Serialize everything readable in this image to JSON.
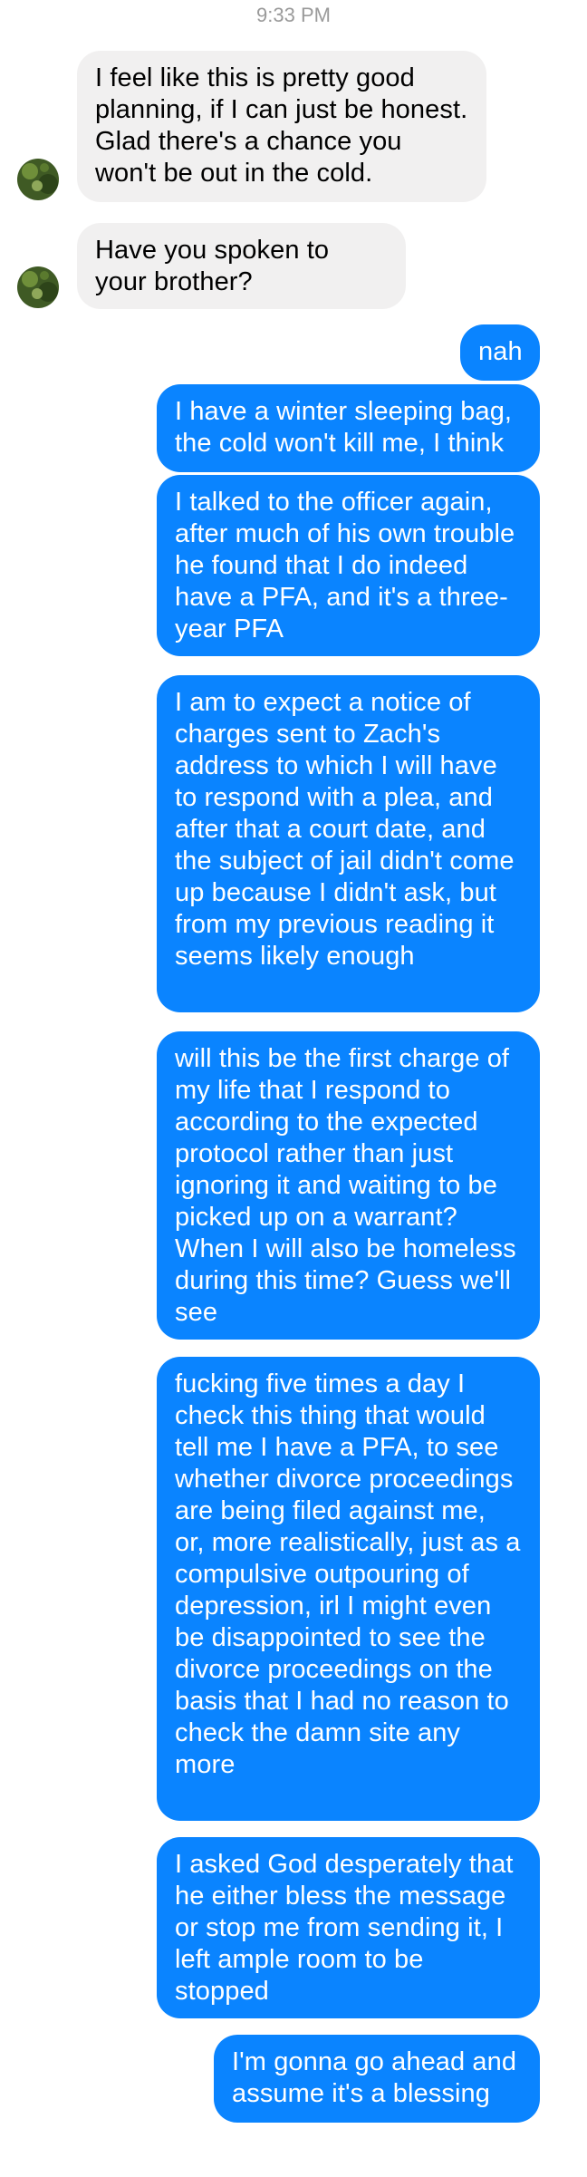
{
  "thread": {
    "timestamp": "9:33 PM"
  },
  "messages": [
    {
      "direction": "incoming",
      "text": "I feel like this is pretty good planning, if I can just be honest. Glad there's a chance you won't be out in the cold."
    },
    {
      "direction": "incoming",
      "text": "Have you spoken to your brother?"
    },
    {
      "direction": "outgoing",
      "text": "nah"
    },
    {
      "direction": "outgoing",
      "text": "I have a winter sleeping bag, the cold won't kill me, I think"
    },
    {
      "direction": "outgoing",
      "text": "I talked to the officer again, after much of his own trouble he found that I do indeed have a PFA, and it's a three-year PFA"
    },
    {
      "direction": "outgoing",
      "text": "I am to expect a notice of charges sent to Zach's address to which I will have to respond with a plea, and after that a court date, and the subject of jail didn't come up because I didn't ask, but from my previous reading it seems likely enough"
    },
    {
      "direction": "outgoing",
      "text": "will this be the first charge of my life that I respond to according to the expected protocol rather than just ignoring it and waiting to be picked up on a warrant? When I will also be homeless during this time? Guess we'll see"
    },
    {
      "direction": "outgoing",
      "text": "fucking five times a day I check this thing that would tell me I have a PFA, to see whether divorce proceedings are being filed against me, or, more realistically, just as a compulsive outpouring of depression, irl I might even be disappointed to see the divorce proceedings on the basis that I had no reason to check the damn site any more"
    },
    {
      "direction": "outgoing",
      "text": "I asked God desperately that he either bless the message or stop me from sending it, I left ample room to be stopped"
    },
    {
      "direction": "outgoing",
      "text": "I'm gonna go ahead and assume it's a blessing"
    }
  ],
  "colors": {
    "incoming_bubble": "#f1f0f0",
    "outgoing_bubble": "#0a84ff",
    "timestamp_text": "#9a9a9a"
  },
  "icons": {
    "avatar": "contact-avatar-photo"
  }
}
